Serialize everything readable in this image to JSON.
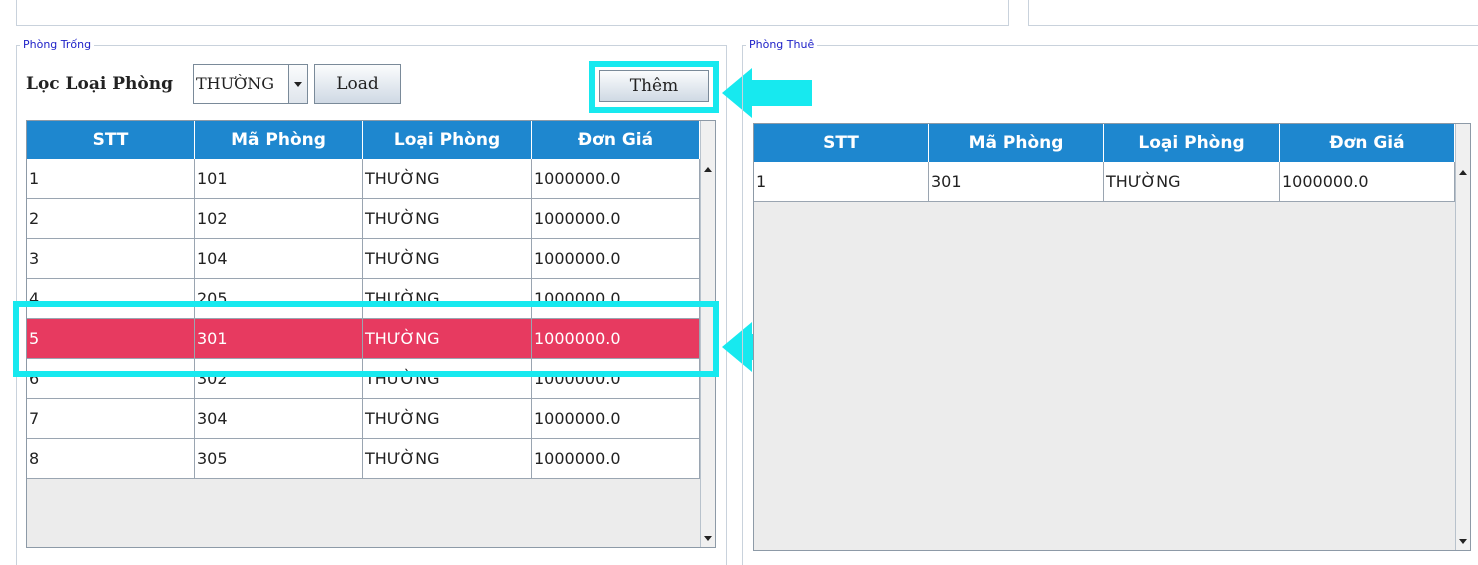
{
  "left_panel": {
    "legend": "Phòng Trống",
    "filter_label": "Lọc Loại Phòng",
    "filter_value": "THƯỜNG",
    "load_button": "Load",
    "add_button": "Thêm",
    "table": {
      "columns": [
        "STT",
        "Mã Phòng",
        "Loại Phòng",
        "Đơn Giá"
      ],
      "rows": [
        [
          "1",
          "101",
          "THƯỜNG",
          "1000000.0"
        ],
        [
          "2",
          "102",
          "THƯỜNG",
          "1000000.0"
        ],
        [
          "3",
          "104",
          "THƯỜNG",
          "1000000.0"
        ],
        [
          "4",
          "205",
          "THƯỜNG",
          "1000000.0"
        ],
        [
          "5",
          "301",
          "THƯỜNG",
          "1000000.0"
        ],
        [
          "6",
          "302",
          "THƯỜNG",
          "1000000.0"
        ],
        [
          "7",
          "304",
          "THƯỜNG",
          "1000000.0"
        ],
        [
          "8",
          "305",
          "THƯỜNG",
          "1000000.0"
        ]
      ],
      "selected_row_index": 4
    }
  },
  "right_panel": {
    "legend": "Phòng Thuê",
    "table": {
      "columns": [
        "STT",
        "Mã Phòng",
        "Loại Phòng",
        "Đơn Giá"
      ],
      "rows": [
        [
          "1",
          "301",
          "THƯỜNG",
          "1000000.0"
        ]
      ]
    }
  },
  "annotations": {
    "highlight_color": "#17e9ef",
    "selected_row_color": "#e73a60",
    "header_color": "#1e87cf"
  }
}
